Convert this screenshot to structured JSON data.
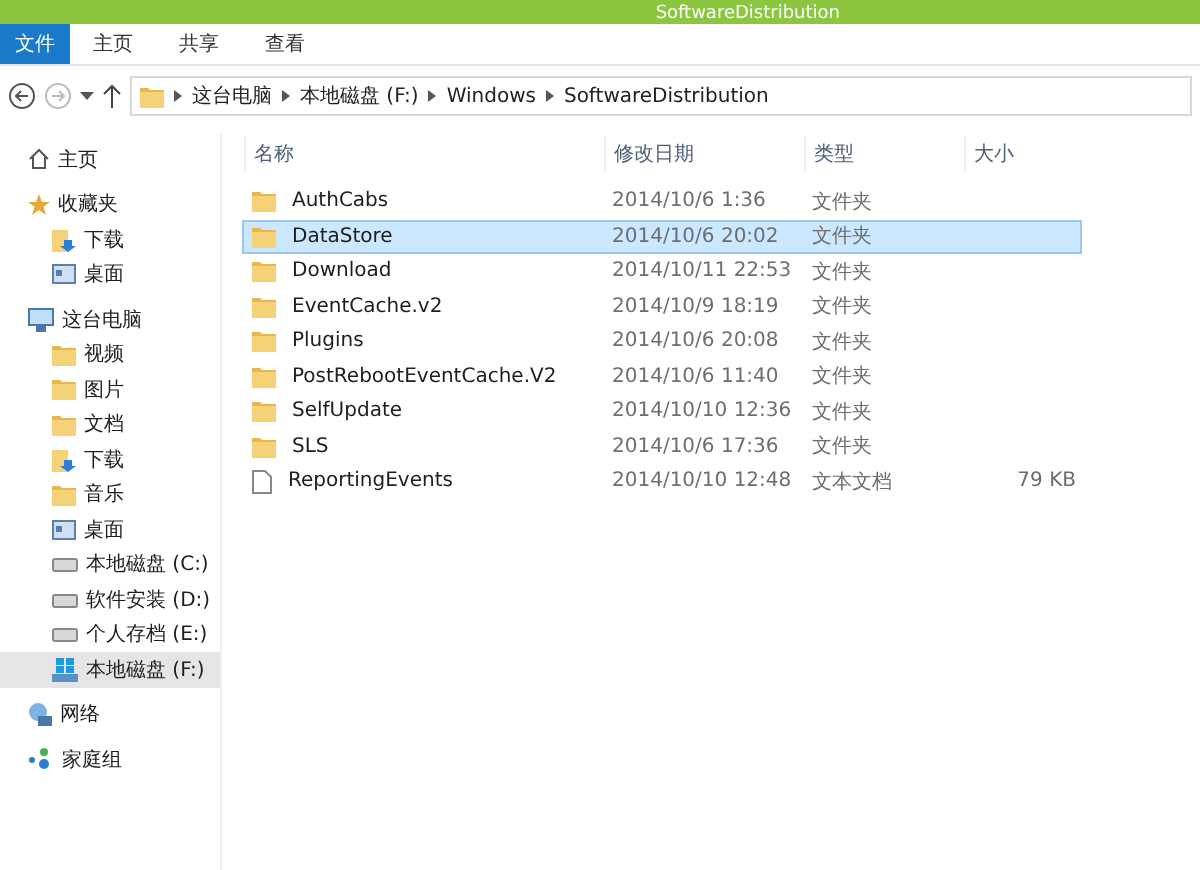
{
  "window": {
    "title": "SoftwareDistribution"
  },
  "ribbon_tabs": [
    {
      "label": "文件",
      "selected": true
    },
    {
      "label": "主页",
      "selected": false
    },
    {
      "label": "共享",
      "selected": false
    },
    {
      "label": "查看",
      "selected": false
    }
  ],
  "address_bar": {
    "crumbs": [
      "这台电脑",
      "本地磁盘 (F:)",
      "Windows",
      "SoftwareDistribution"
    ]
  },
  "sidebar": {
    "items": [
      {
        "label": "主页",
        "kind": "home",
        "selected": false
      },
      {
        "label": "收藏夹",
        "kind": "star",
        "selected": false,
        "children": [
          {
            "label": "下载",
            "kind": "download",
            "selected": false
          },
          {
            "label": "桌面",
            "kind": "desktop",
            "selected": false
          }
        ]
      },
      {
        "label": "这台电脑",
        "kind": "computer",
        "selected": false,
        "children": [
          {
            "label": "视频",
            "kind": "folder",
            "selected": false
          },
          {
            "label": "图片",
            "kind": "folder",
            "selected": false
          },
          {
            "label": "文档",
            "kind": "folder",
            "selected": false
          },
          {
            "label": "下载",
            "kind": "download",
            "selected": false
          },
          {
            "label": "音乐",
            "kind": "folder",
            "selected": false
          },
          {
            "label": "桌面",
            "kind": "desktop",
            "selected": false
          },
          {
            "label": "本地磁盘 (C:)",
            "kind": "drive",
            "selected": false
          },
          {
            "label": "软件安装 (D:)",
            "kind": "drive",
            "selected": false
          },
          {
            "label": "个人存档 (E:)",
            "kind": "drive",
            "selected": false
          },
          {
            "label": "本地磁盘 (F:)",
            "kind": "system-drive",
            "selected": true
          }
        ]
      },
      {
        "label": "网络",
        "kind": "network",
        "selected": false
      },
      {
        "label": "家庭组",
        "kind": "homegroup",
        "selected": false
      }
    ]
  },
  "table": {
    "columns": [
      "名称",
      "修改日期",
      "类型",
      "大小"
    ],
    "rows": [
      {
        "name": "AuthCabs",
        "date": "2014/10/6 1:36",
        "type": "文件夹",
        "kind": "folder",
        "selected": false
      },
      {
        "name": "DataStore",
        "date": "2014/10/6 20:02",
        "type": "文件夹",
        "kind": "folder",
        "selected": true
      },
      {
        "name": "Download",
        "date": "2014/10/11 22:53",
        "type": "文件夹",
        "kind": "folder",
        "selected": false
      },
      {
        "name": "EventCache.v2",
        "date": "2014/10/9 18:19",
        "type": "文件夹",
        "kind": "folder",
        "selected": false
      },
      {
        "name": "Plugins",
        "date": "2014/10/6 20:08",
        "type": "文件夹",
        "kind": "folder",
        "selected": false
      },
      {
        "name": "PostRebootEventCache.V2",
        "date": "2014/10/6 11:40",
        "type": "文件夹",
        "kind": "folder",
        "selected": false
      },
      {
        "name": "SelfUpdate",
        "date": "2014/10/10 12:36",
        "type": "文件夹",
        "kind": "folder",
        "selected": false
      },
      {
        "name": "SLS",
        "date": "2014/10/6 17:36",
        "type": "文件夹",
        "kind": "folder",
        "selected": false
      },
      {
        "name": "ReportingEvents",
        "date": "2014/10/10 12:48",
        "type": "文本文档",
        "size": "79 KB",
        "kind": "file",
        "selected": false
      }
    ]
  }
}
